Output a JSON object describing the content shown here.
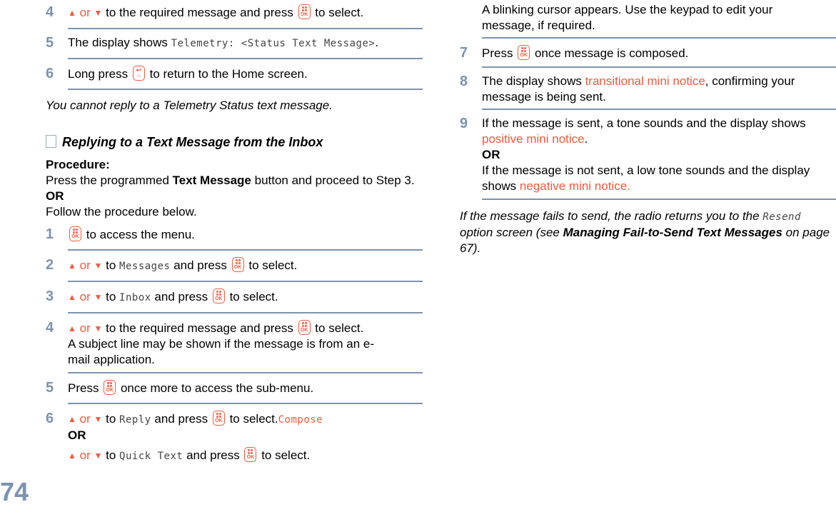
{
  "page_number": "74",
  "top_steps": [
    {
      "num": "4",
      "prefix_up": "▲",
      "or": "or",
      "prefix_down": "▼",
      "text_a": "to the required message and press",
      "text_b": "to select."
    },
    {
      "num": "5",
      "text_a": "The display shows",
      "mono": "Telemetry: <Status Text Message>",
      "text_b": "."
    },
    {
      "num": "6",
      "text_a": "Long press",
      "text_b": "to return to the Home screen."
    }
  ],
  "note_telemetry": "You cannot reply to a Telemetry Status text message.",
  "section": {
    "icon": "document-stack-icon",
    "title": "Replying to a Text Message from the Inbox",
    "procedure_label": "Procedure:",
    "intro_a": "Press the programmed",
    "intro_bold": "Text Message",
    "intro_b": "button and proceed to Step 3.",
    "or": "OR",
    "follow": "Follow the procedure below."
  },
  "steps": [
    {
      "num": "1",
      "text_b": "to access the menu."
    },
    {
      "num": "2",
      "or": "or",
      "text_a": "to",
      "mono": "Messages",
      "text_b": "and press",
      "text_c": "to select."
    },
    {
      "num": "3",
      "or": "or",
      "text_a": "to",
      "mono": "Inbox",
      "text_b": "and press",
      "text_c": "to select."
    },
    {
      "num": "4",
      "or": "or",
      "text_a": "to the required message and press",
      "text_c": "to select.",
      "extra": "A subject line may be shown if the message is from an e-mail application."
    },
    {
      "num": "5",
      "text_a": "Press",
      "text_b": "once more to access the sub-menu."
    },
    {
      "num": "6",
      "or": "or",
      "text_a": "to",
      "mono": "Reply",
      "text_b": "and press",
      "text_c": "to select.",
      "mono_orange": "Compose",
      "or2": "OR",
      "text_a2": "to",
      "mono2": "Quick Text",
      "text_b2": "and press",
      "text_c2": "to select.",
      "extra": "A blinking cursor appears. Use the keypad to edit your message, if required."
    },
    {
      "num": "7",
      "text_a": "Press",
      "text_b": "once message is composed."
    },
    {
      "num": "8",
      "text_a": "The display shows",
      "orange": "transitional mini notice",
      "text_b": ", confirming your message is being sent."
    },
    {
      "num": "9",
      "text_a": "If the message is sent, a tone sounds and the display shows",
      "orange": "positive mini notice",
      "text_b": ".",
      "or": "OR",
      "text_c": "If the message is not sent, a low tone sounds and the display shows",
      "orange2": "negative mini notice."
    }
  ],
  "footer_note": {
    "text_a": "If the message fails to send, the radio returns you to the",
    "mono": "Resend",
    "text_b": "option screen (see",
    "bold": "Managing Fail-to-Send Text Messages",
    "text_c": "on page 67)."
  },
  "colors": {
    "accent": "#f05a3c",
    "rule": "#7d93ad",
    "step_number": "#7a93b0"
  }
}
